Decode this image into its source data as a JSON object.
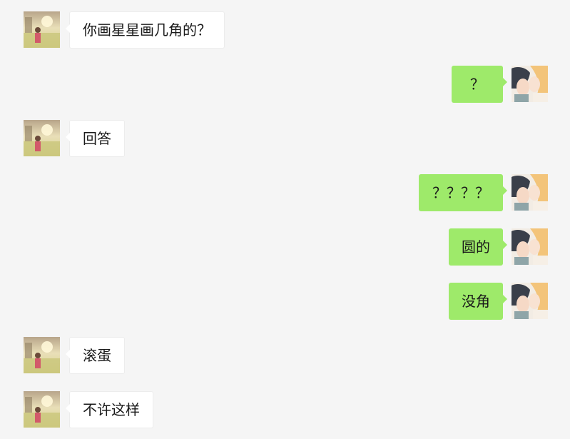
{
  "conversation": {
    "messages": [
      {
        "side": "left",
        "text": "你画星星画几角的？",
        "avatar": "contact-avatar"
      },
      {
        "side": "right",
        "text": "？",
        "avatar": "self-avatar"
      },
      {
        "side": "left",
        "text": "回答",
        "avatar": "contact-avatar"
      },
      {
        "side": "right",
        "text": "？？？？",
        "avatar": "self-avatar"
      },
      {
        "side": "right",
        "text": "圆的",
        "avatar": "self-avatar"
      },
      {
        "side": "right",
        "text": "没角",
        "avatar": "self-avatar"
      },
      {
        "side": "left",
        "text": "滚蛋",
        "avatar": "contact-avatar"
      },
      {
        "side": "left",
        "text": "不许这样",
        "avatar": "contact-avatar"
      }
    ]
  },
  "colors": {
    "background": "#f5f5f5",
    "incoming_bubble": "#ffffff",
    "outgoing_bubble": "#9eea6a",
    "text": "#1a1a1a"
  }
}
